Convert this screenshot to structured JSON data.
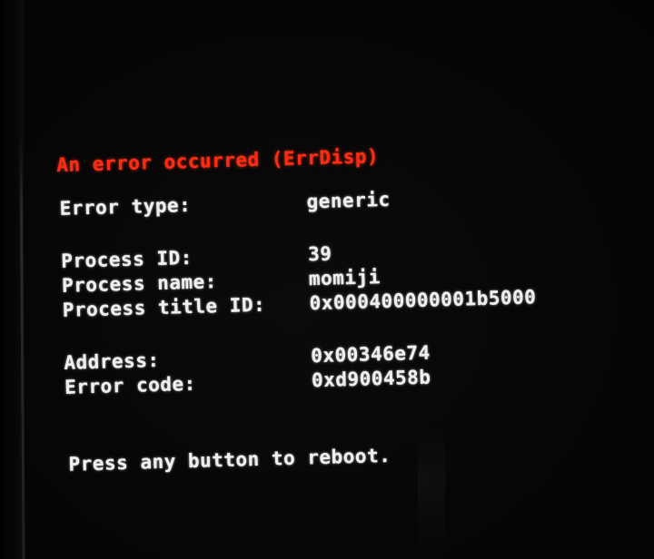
{
  "error_screen": {
    "title": "An error occurred (ErrDisp)",
    "fields": [
      {
        "label": "Error type:",
        "value": "generic"
      },
      {
        "label": "Process ID:",
        "value": "39"
      },
      {
        "label": "Process name:",
        "value": "momiji"
      },
      {
        "label": "Process title ID:",
        "value": "0x000400000001b5000"
      },
      {
        "label": "Address:",
        "value": "0x00346e74"
      },
      {
        "label": "Error code:",
        "value": "0xd900458b"
      }
    ],
    "footer": "Press any button to reboot."
  },
  "colors": {
    "title": "#ff2a14",
    "text": "#efefef",
    "background": "#050505"
  }
}
